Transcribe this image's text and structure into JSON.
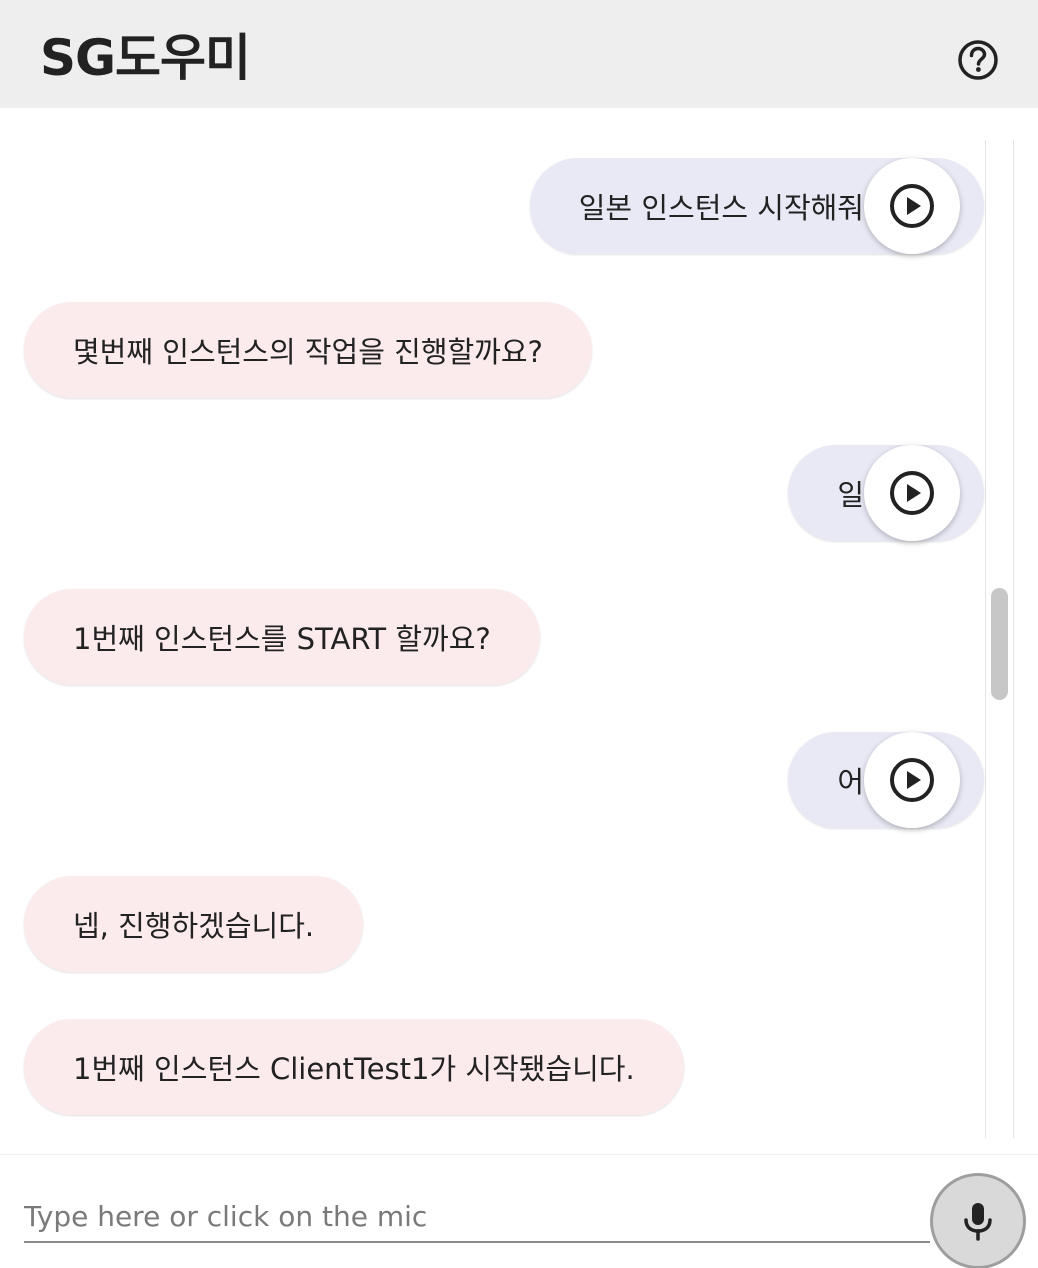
{
  "header": {
    "title": "SG도우미",
    "help_icon": "help-circle-icon"
  },
  "messages": [
    {
      "sender": "user",
      "text": "일본 인스턴스 시작해줘",
      "action_icon": "play-circle-icon"
    },
    {
      "sender": "bot",
      "text": "몇번째 인스턴스의 작업을 진행할까요?"
    },
    {
      "sender": "user",
      "text": "일",
      "action_icon": "play-circle-icon"
    },
    {
      "sender": "bot",
      "text": "1번째 인스턴스를 START 할까요?"
    },
    {
      "sender": "user",
      "text": "어",
      "action_icon": "play-circle-icon"
    },
    {
      "sender": "bot",
      "text": "넵, 진행하겠습니다."
    },
    {
      "sender": "bot",
      "text": "1번째 인스턴스 ClientTest1가 시작됐습니다."
    }
  ],
  "input": {
    "placeholder": "Type here or click on the mic",
    "value": "",
    "mic_icon": "microphone-icon"
  },
  "colors": {
    "header_bg": "#eeeeee",
    "user_bubble": "#e8e9f5",
    "bot_bubble": "#fcebec",
    "mic_bg": "#d9d9d9"
  }
}
